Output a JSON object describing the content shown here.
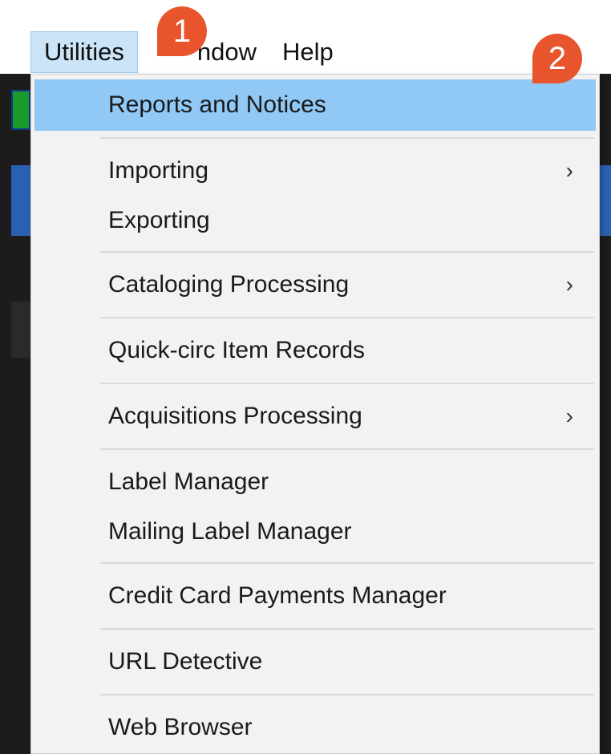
{
  "menubar": {
    "items": [
      {
        "label": "Utilities"
      },
      {
        "label": "ndow"
      },
      {
        "label": "Help"
      }
    ]
  },
  "menu": {
    "items": [
      {
        "label": "Reports and Notices"
      },
      {
        "label": "Importing"
      },
      {
        "label": "Exporting"
      },
      {
        "label": "Cataloging Processing"
      },
      {
        "label": "Quick-circ Item Records"
      },
      {
        "label": "Acquisitions Processing"
      },
      {
        "label": "Label Manager"
      },
      {
        "label": "Mailing Label Manager"
      },
      {
        "label": "Credit Card Payments Manager"
      },
      {
        "label": "URL Detective"
      },
      {
        "label": "Web Browser"
      }
    ],
    "submenu_glyph": "›"
  },
  "callouts": [
    {
      "number": "1"
    },
    {
      "number": "2"
    }
  ],
  "colors": {
    "highlight": "#90c8f6",
    "menubar_active": "#cce4f7",
    "callout": "#e8552c"
  }
}
